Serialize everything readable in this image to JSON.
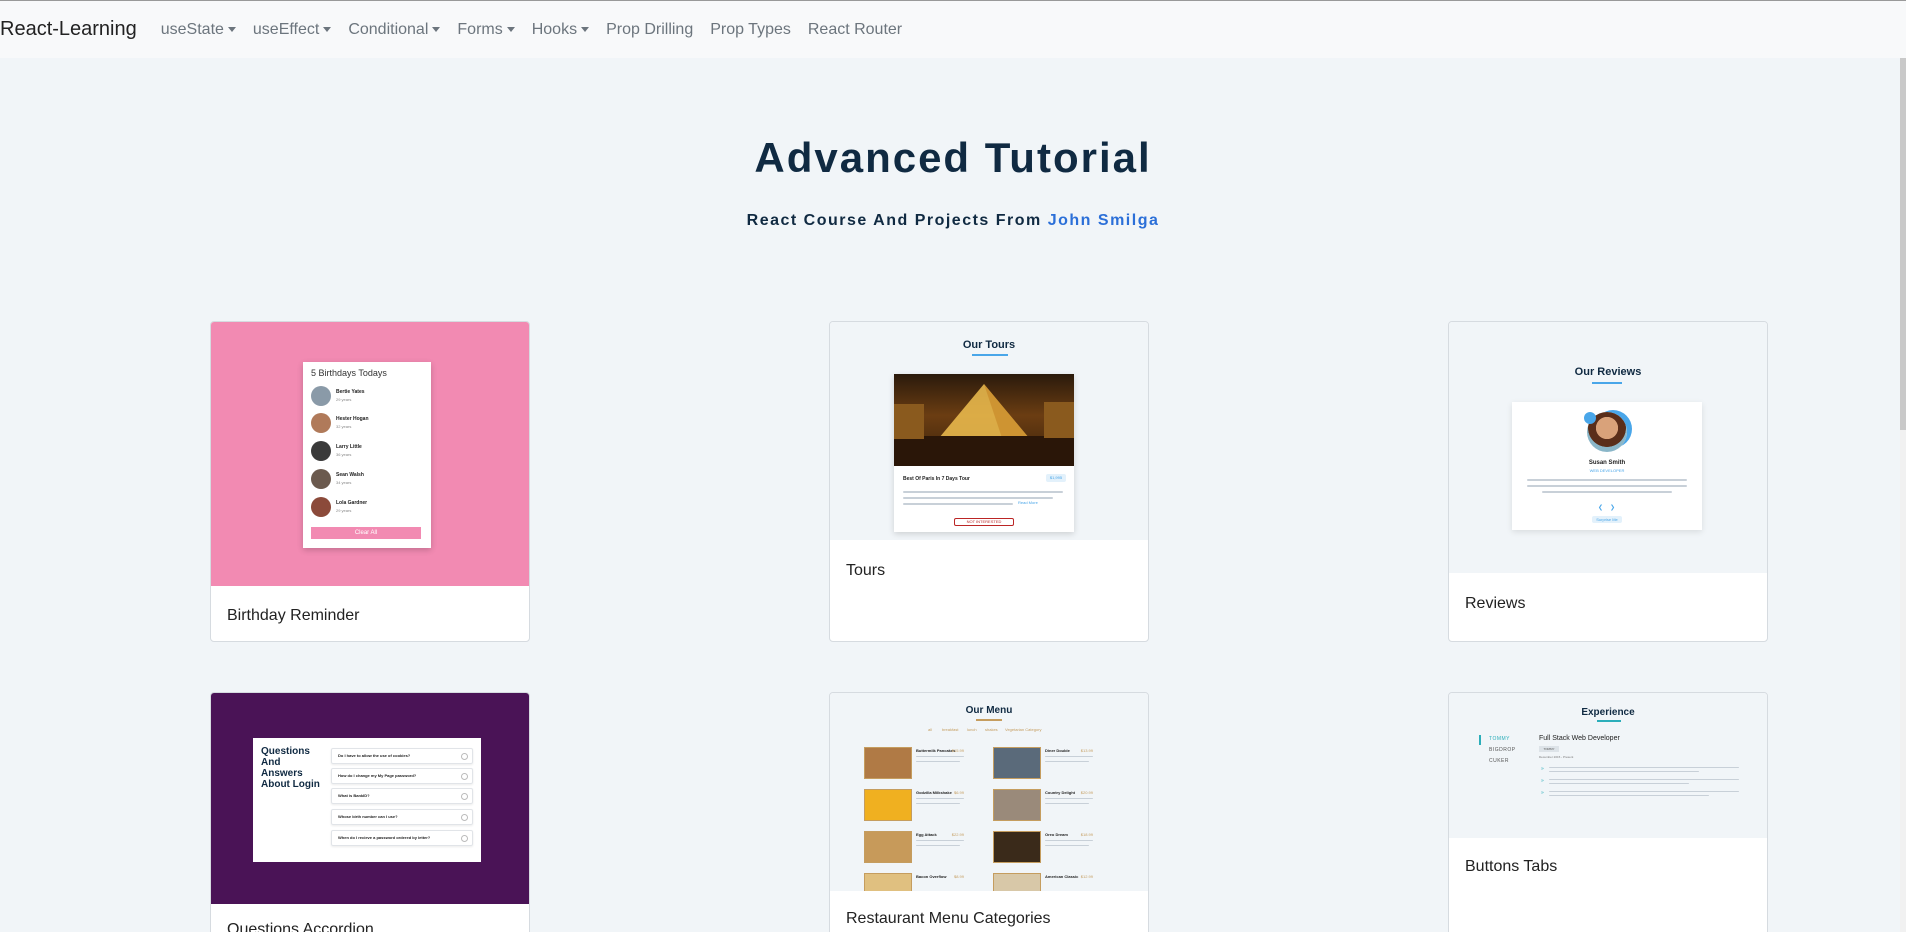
{
  "navbar": {
    "brand": "React-Learning",
    "links": [
      {
        "label": "useState",
        "dropdown": true
      },
      {
        "label": "useEffect",
        "dropdown": true
      },
      {
        "label": "Conditional",
        "dropdown": true
      },
      {
        "label": "Forms",
        "dropdown": true
      },
      {
        "label": "Hooks",
        "dropdown": true
      },
      {
        "label": "Prop Drilling",
        "dropdown": false
      },
      {
        "label": "Prop Types",
        "dropdown": false
      },
      {
        "label": "React Router",
        "dropdown": false
      }
    ]
  },
  "hero": {
    "title": "Advanced Tutorial",
    "subtitle_prefix": "React Course And Projects From",
    "author": "John Smilga"
  },
  "colors": {
    "accent": "#2b6fd8",
    "heading": "#102a42",
    "birthday_bg": "#f28ab2",
    "accordion_bg": "#4a1356",
    "tabs_accent": "#2caeba",
    "menu_gold": "#c59d5f",
    "tours_blue": "#49a6e9"
  },
  "cards": [
    {
      "title": "Birthday Reminder",
      "preview": {
        "heading": "5 Birthdays Todays",
        "people": [
          {
            "name": "Bertie Yates",
            "age": "29 years"
          },
          {
            "name": "Hester Hogan",
            "age": "32 years"
          },
          {
            "name": "Larry Little",
            "age": "36 years"
          },
          {
            "name": "Sean Walsh",
            "age": "34 years"
          },
          {
            "name": "Lola Gardner",
            "age": "29 years"
          }
        ],
        "button": "Clear All"
      }
    },
    {
      "title": "Tours",
      "preview": {
        "heading": "Our Tours",
        "tour_name": "Best Of Paris In 7 Days Tour",
        "price": "$1,995",
        "read_more": "Read More",
        "button": "NOT INTERESTED"
      }
    },
    {
      "title": "Reviews",
      "preview": {
        "heading": "Our Reviews",
        "person": "Susan Smith",
        "job": "WEB DEVELOPER",
        "button": "Surprise Me"
      }
    },
    {
      "title": "Questions Accordion",
      "preview": {
        "heading": "Questions And Answers About Login",
        "questions": [
          "Do I have to allow the use of cookies?",
          "How do I change my My Page password?",
          "What is BankID?",
          "Whose birth number can I use?",
          "When do I recieve a password ordered by letter?"
        ]
      }
    },
    {
      "title": "Restaurant Menu Categories",
      "preview": {
        "heading": "Our Menu",
        "categories": [
          "all",
          "breakfast",
          "lunch",
          "shakes",
          "Vegetarian Category"
        ],
        "items": [
          {
            "name": "Buttermilk Pancakes",
            "price": "$15.99"
          },
          {
            "name": "Diner Double",
            "price": "$13.99"
          },
          {
            "name": "Godzilla Milkshake",
            "price": "$6.99"
          },
          {
            "name": "Country Delight",
            "price": "$20.99"
          },
          {
            "name": "Egg Attack",
            "price": "$22.99"
          },
          {
            "name": "Oreo Dream",
            "price": "$18.99"
          },
          {
            "name": "Bacon Overflow",
            "price": "$8.99"
          },
          {
            "name": "American Classic",
            "price": "$12.99"
          }
        ]
      }
    },
    {
      "title": "Buttons Tabs",
      "preview": {
        "heading": "Experience",
        "tabs": [
          "TOMMY",
          "BIGDROP",
          "CUKER"
        ],
        "job_title": "Full Stack Web Developer",
        "company": "TOMMY",
        "dates": "December 2015 - Present"
      }
    }
  ]
}
